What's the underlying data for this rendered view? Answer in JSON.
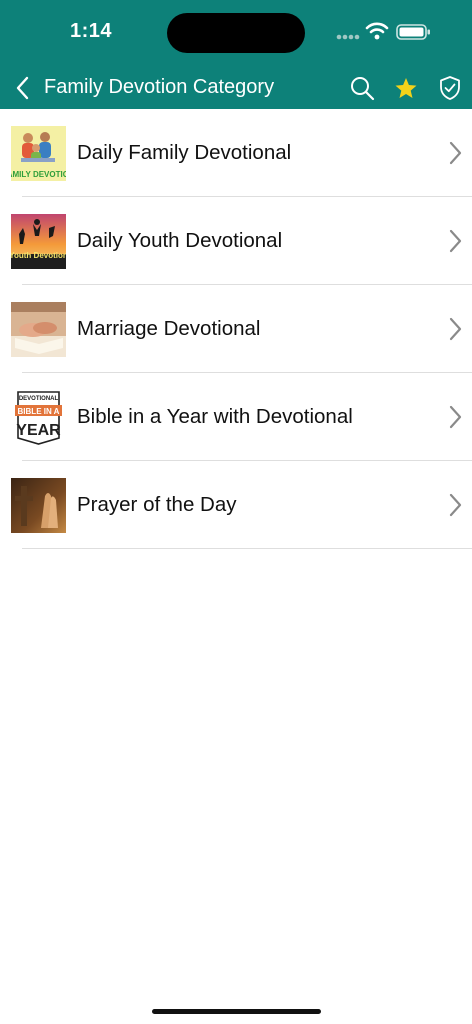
{
  "status": {
    "time": "1:14"
  },
  "nav": {
    "title": "Family Devotion Category",
    "icons": [
      "chevron-left-icon",
      "search-icon",
      "star-icon",
      "shield-check-icon"
    ]
  },
  "colors": {
    "header": "#0d8179",
    "star": "#f2d21a"
  },
  "items": [
    {
      "label": "Daily Family Devotional",
      "thumb_text": "FAMILY DEVOTION",
      "icon": "family-thumbnail"
    },
    {
      "label": "Daily Youth Devotional",
      "thumb_text": "Youth Devotion",
      "icon": "youth-thumbnail"
    },
    {
      "label": "Marriage Devotional",
      "icon": "marriage-thumbnail"
    },
    {
      "label": "Bible in a Year with Devotional",
      "thumb_text_top": "DEVOTIONAL",
      "thumb_text_mid": "BIBLE IN A",
      "thumb_text_bottom": "YEAR",
      "icon": "bible-year-thumbnail"
    },
    {
      "label": "Prayer of the Day",
      "icon": "prayer-thumbnail"
    }
  ]
}
